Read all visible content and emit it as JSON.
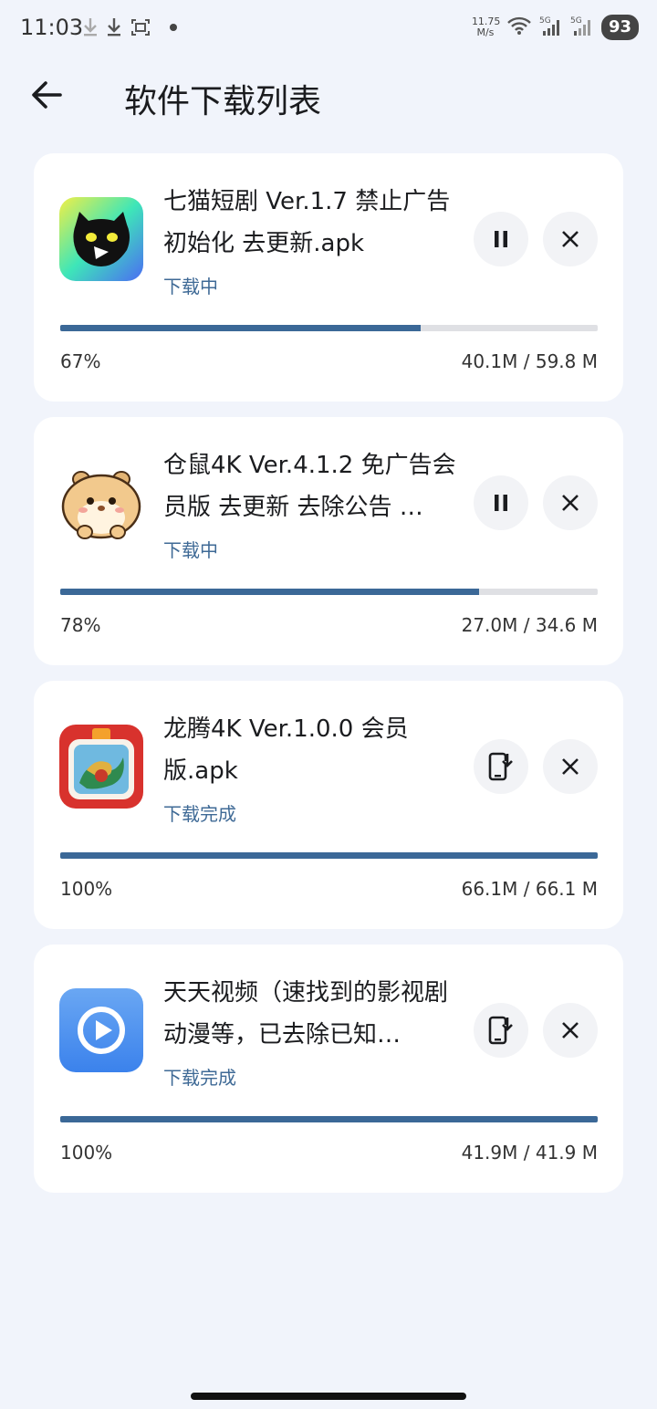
{
  "status_bar": {
    "time": "11:03",
    "net_speed_value": "11.75",
    "net_speed_unit": "M/s",
    "battery": "93",
    "icons": [
      "download-icon",
      "download-icon",
      "screenshot-icon",
      "wifi-icon",
      "signal-5g-icon",
      "signal-5g-icon"
    ]
  },
  "header": {
    "title": "软件下载列表",
    "back_icon": "arrow-left-icon"
  },
  "downloads": [
    {
      "name": "七猫短剧 Ver.1.7 禁止广告初始化 去更新.apk",
      "status": "下载中",
      "progress_label": "67%",
      "progress": 0.67,
      "size": "40.1M / 59.8 M",
      "action_icon": "pause-icon",
      "close_icon": "close-icon"
    },
    {
      "name": "仓鼠4K Ver.4.1.2 免广告会员版 去更新 去除公告 …",
      "status": "下载中",
      "progress_label": "78%",
      "progress": 0.78,
      "size": "27.0M / 34.6 M",
      "action_icon": "pause-icon",
      "close_icon": "close-icon"
    },
    {
      "name": "龙腾4K Ver.1.0.0 会员版.apk",
      "status": "下载完成",
      "progress_label": "100%",
      "progress": 1.0,
      "size": "66.1M / 66.1 M",
      "action_icon": "install-icon",
      "close_icon": "close-icon"
    },
    {
      "name": "天天视频（速找到的影视剧动漫等，已去除已知…",
      "status": "下载完成",
      "progress_label": "100%",
      "progress": 1.0,
      "size": "41.9M / 41.9 M",
      "action_icon": "install-icon",
      "close_icon": "close-icon"
    }
  ],
  "colors": {
    "background": "#f1f4fb",
    "card": "#ffffff",
    "progress": "#3b6897",
    "track": "#dfe0e4",
    "status_text": "#3f6a96"
  }
}
